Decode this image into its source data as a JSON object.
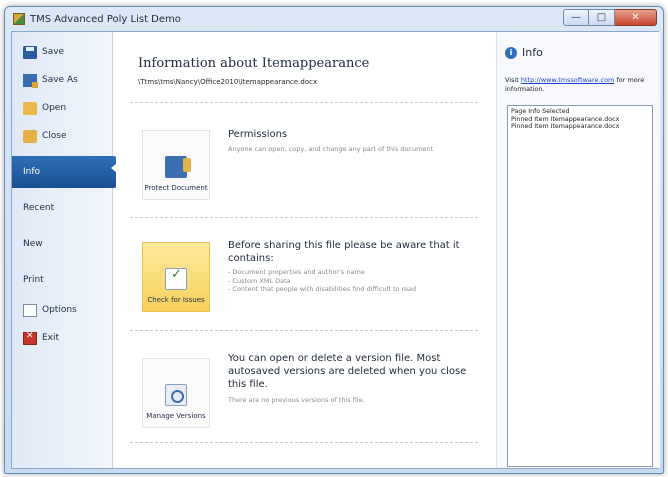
{
  "window": {
    "title": "TMS Advanced Poly List Demo",
    "controls": {
      "minimize": "—",
      "maximize": "□",
      "close": "✕"
    }
  },
  "sidebar": {
    "items": [
      {
        "label": "Save",
        "icon": "save-icon"
      },
      {
        "label": "Save As",
        "icon": "save-as-icon"
      },
      {
        "label": "Open",
        "icon": "open-folder-icon"
      },
      {
        "label": "Close",
        "icon": "close-folder-icon"
      },
      {
        "label": "Info",
        "icon": "",
        "selected": true
      },
      {
        "label": "Recent",
        "icon": ""
      },
      {
        "label": "New",
        "icon": ""
      },
      {
        "label": "Print",
        "icon": ""
      },
      {
        "label": "Options",
        "icon": "options-icon"
      },
      {
        "label": "Exit",
        "icon": "exit-icon"
      }
    ]
  },
  "main": {
    "title": "Information about Itemappearance",
    "path": "\\Ttms\\tms\\Nancy\\Office2010\\Itemappearance.docx",
    "sections": [
      {
        "tile_label": "Protect Document",
        "heading": "Permissions",
        "description": "Anyone can open, copy, and change any part of this document"
      },
      {
        "tile_label": "Check for Issues",
        "heading": "Before sharing this file please be aware that it contains:",
        "description": "- Document properties and author's name\n- Custom XML Data\n- Content that people with disabilities find difficult to read"
      },
      {
        "tile_label": "Manage Versions",
        "heading": "You can open or delete a version file. Most autosaved versions are deleted when you close this file.",
        "description": "There are no previous versions of this file."
      }
    ]
  },
  "info_panel": {
    "title": "Info",
    "visit_prefix": "Visit ",
    "link": "http://www.tmssoftware.com",
    "visit_suffix": " for more information.",
    "list_items": [
      "Page Info Selected",
      "Pinned Item Itemappearance.docx",
      "Pinned Item Itemappearance.docx"
    ]
  },
  "colors": {
    "selected_menu": "#1b4f91",
    "highlight_tile": "#f7d15c",
    "link": "#1a44c4"
  }
}
